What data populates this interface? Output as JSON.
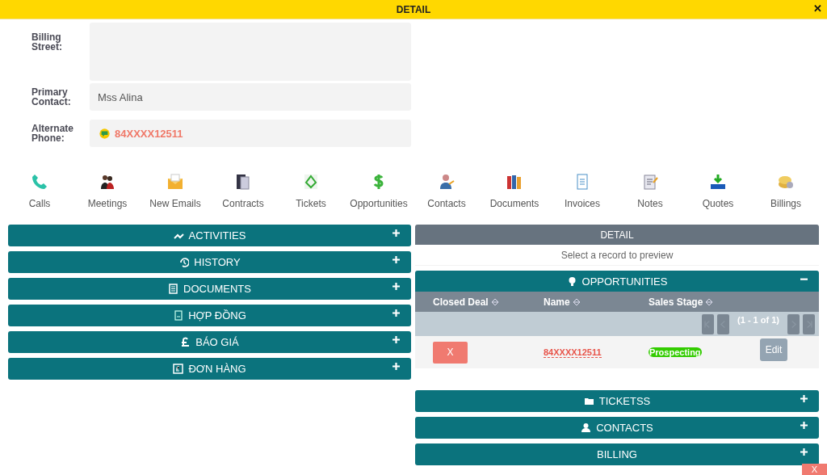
{
  "header": {
    "title": "DETAIL",
    "close": "✕"
  },
  "fields": [
    {
      "label": "Billing Street:",
      "kind": "textarea"
    },
    {
      "label": "Primary Contact:",
      "kind": "text",
      "value": "Mss Alina"
    },
    {
      "label": "Alternate Phone:",
      "kind": "phone",
      "value": "84XXXX12511"
    }
  ],
  "modules": [
    {
      "label": "Calls"
    },
    {
      "label": "Meetings"
    },
    {
      "label": "New Emails"
    },
    {
      "label": "Contracts"
    },
    {
      "label": "Tickets"
    },
    {
      "label": "Opportunities"
    },
    {
      "label": "Contacts"
    },
    {
      "label": "Documents"
    },
    {
      "label": "Invoices"
    },
    {
      "label": "Notes"
    },
    {
      "label": "Quotes"
    },
    {
      "label": "Billings"
    }
  ],
  "left_panels": [
    {
      "title": "ACTIVITIES",
      "expanded": false
    },
    {
      "title": "HISTORY",
      "expanded": false
    },
    {
      "title": "DOCUMENTS",
      "expanded": false
    },
    {
      "title": "HỢP ĐỒNG",
      "expanded": false
    },
    {
      "title": "BÁO GIÁ",
      "expanded": false
    },
    {
      "title": "ĐƠN HÀNG",
      "expanded": false
    }
  ],
  "detail_panel": {
    "title": "DETAIL",
    "message": "Select a record to preview"
  },
  "opportunities": {
    "title": "OPPORTUNITIES",
    "expanded": true,
    "columns": [
      "Closed Deal",
      "Name",
      "Sales Stage"
    ],
    "pager": "(1 - 1 of 1)",
    "rows": [
      {
        "closed_deal": "X",
        "name": "84XXXX12511",
        "sales_stage": "Prospecting",
        "action": "Edit"
      }
    ]
  },
  "right_panels": [
    {
      "title": "TICKETSS",
      "expanded": false
    },
    {
      "title": "CONTACTS",
      "expanded": false
    },
    {
      "title": "BILLING",
      "expanded": false
    }
  ],
  "footer_button": "X"
}
